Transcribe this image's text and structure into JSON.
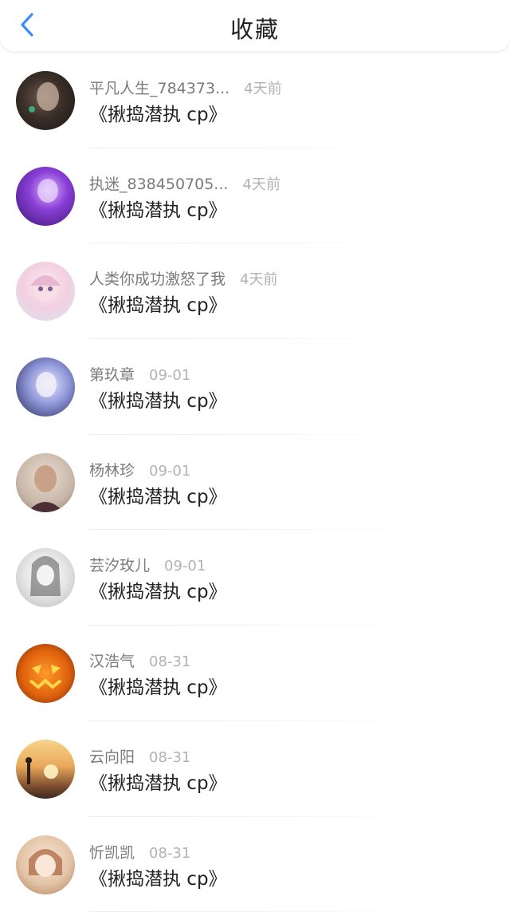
{
  "header": {
    "title": "收藏",
    "back_icon": "chevron-left-icon",
    "accent_color": "#3b8ff3"
  },
  "favorites": [
    {
      "user": "平凡人生_784373...",
      "time": "4天前",
      "content": "《揪捣潜执 cp》"
    },
    {
      "user": "执迷_838450705...",
      "time": "4天前",
      "content": "《揪捣潜执 cp》"
    },
    {
      "user": "人类你成功激怒了我",
      "time": "4天前",
      "content": "《揪捣潜执 cp》"
    },
    {
      "user": "第玖章",
      "time": "09-01",
      "content": "《揪捣潜执 cp》"
    },
    {
      "user": "杨林珍",
      "time": "09-01",
      "content": "《揪捣潜执 cp》"
    },
    {
      "user": "芸汐玫儿",
      "time": "09-01",
      "content": "《揪捣潜执 cp》"
    },
    {
      "user": "汉浩气",
      "time": "08-31",
      "content": "《揪捣潜执 cp》"
    },
    {
      "user": "云向阳",
      "time": "08-31",
      "content": "《揪捣潜执 cp》"
    },
    {
      "user": "忻凯凯",
      "time": "08-31",
      "content": "《揪捣潜执 cp》"
    }
  ]
}
